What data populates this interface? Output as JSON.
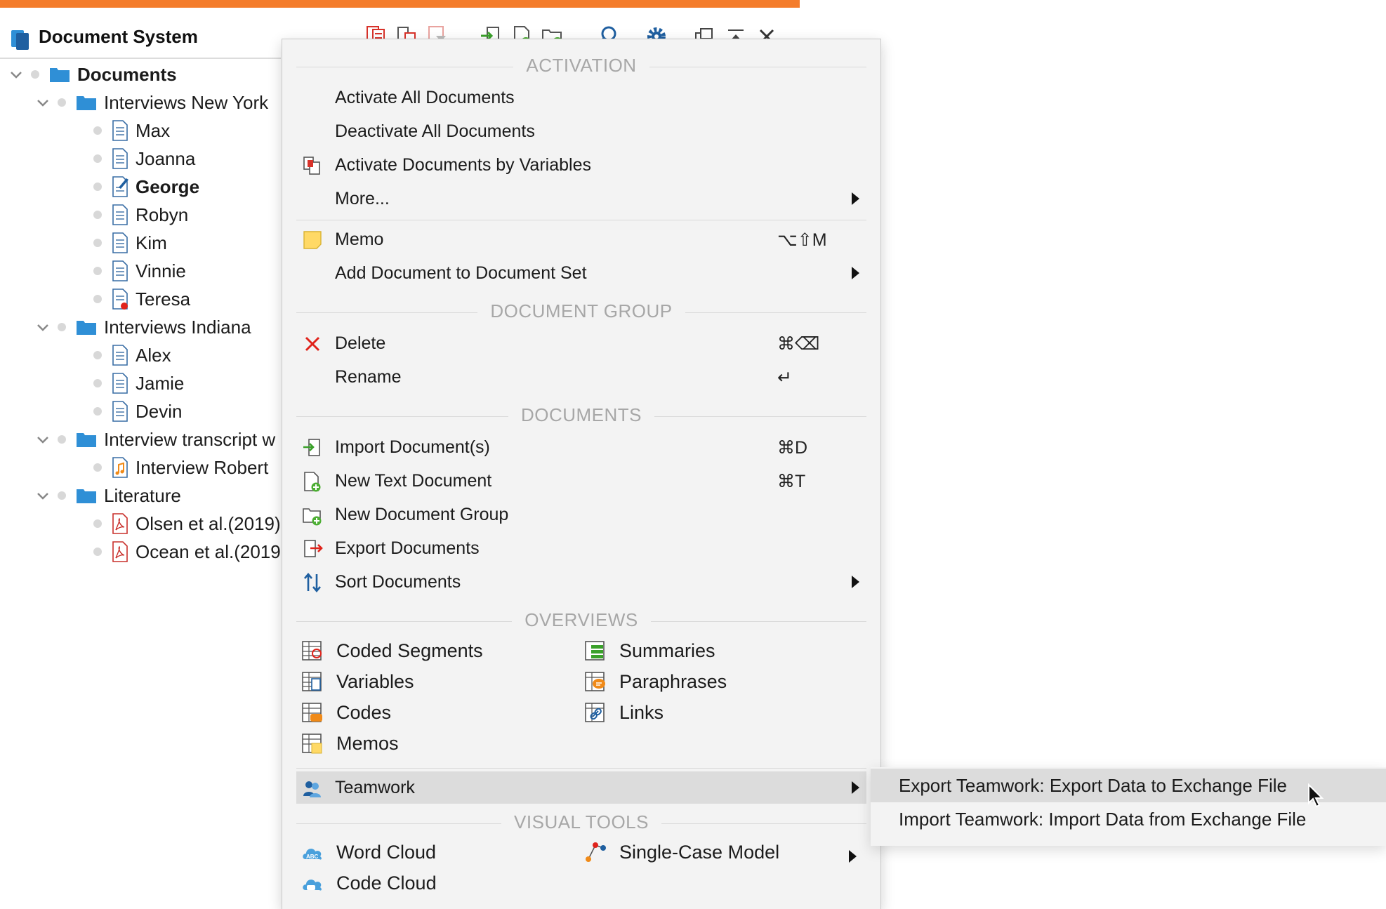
{
  "window": {
    "title": "Document System",
    "toolbar_icons": [
      "document-stack-icon",
      "activate-icon",
      "filter-icon",
      "import-icon",
      "new-document-icon",
      "new-group-icon",
      "search-icon",
      "gear-icon",
      "undock-icon",
      "collapse-icon",
      "close-icon"
    ]
  },
  "tree": {
    "root": "Documents",
    "groups": [
      {
        "label": "Interviews New York",
        "docs": [
          "Max",
          "Joanna",
          "George",
          "Robyn",
          "Kim",
          "Vinnie",
          "Teresa"
        ]
      },
      {
        "label": "Interviews Indiana",
        "docs": [
          "Alex",
          "Jamie",
          "Devin"
        ]
      },
      {
        "label": "Interview transcript w",
        "docs": [
          "Interview Robert"
        ]
      },
      {
        "label": "Literature",
        "docs": [
          "Olsen et al.(2019)",
          "Ocean et al.(2019"
        ]
      }
    ]
  },
  "menu": {
    "sections": {
      "activation": "ACTIVATION",
      "document_group": "DOCUMENT GROUP",
      "documents": "DOCUMENTS",
      "overviews": "OVERVIEWS",
      "visual_tools": "VISUAL TOOLS"
    },
    "activation": {
      "activate_all": "Activate All Documents",
      "deactivate_all": "Deactivate All Documents",
      "activate_by_variables": "Activate Documents by Variables",
      "more": "More..."
    },
    "memo": {
      "label": "Memo",
      "shortcut": "⌥⇧M"
    },
    "add_to_set": "Add Document to Document Set",
    "group": {
      "delete": {
        "label": "Delete",
        "shortcut": "⌘⌫"
      },
      "rename": {
        "label": "Rename",
        "shortcut": "↵"
      }
    },
    "documents": {
      "import": {
        "label": "Import Document(s)",
        "shortcut": "⌘D"
      },
      "new_text": {
        "label": "New Text Document",
        "shortcut": "⌘T"
      },
      "new_group": "New Document Group",
      "export": "Export Documents",
      "sort": "Sort Documents"
    },
    "overviews": {
      "coded_segments": "Coded Segments",
      "variables": "Variables",
      "codes": "Codes",
      "memos": "Memos",
      "summaries": "Summaries",
      "paraphrases": "Paraphrases",
      "links": "Links"
    },
    "teamwork": "Teamwork",
    "visual_tools": {
      "word_cloud": "Word Cloud",
      "code_cloud": "Code Cloud",
      "single_case": "Single-Case Model"
    }
  },
  "submenu": {
    "export_teamwork": "Export Teamwork: Export Data to Exchange File",
    "import_teamwork": "Import Teamwork: Import Data from Exchange File"
  },
  "colors": {
    "accent": "#f47c2b",
    "folder": "#2f8fd6",
    "doc": "#3a6ea5",
    "highlight": "#dcdcdc"
  }
}
